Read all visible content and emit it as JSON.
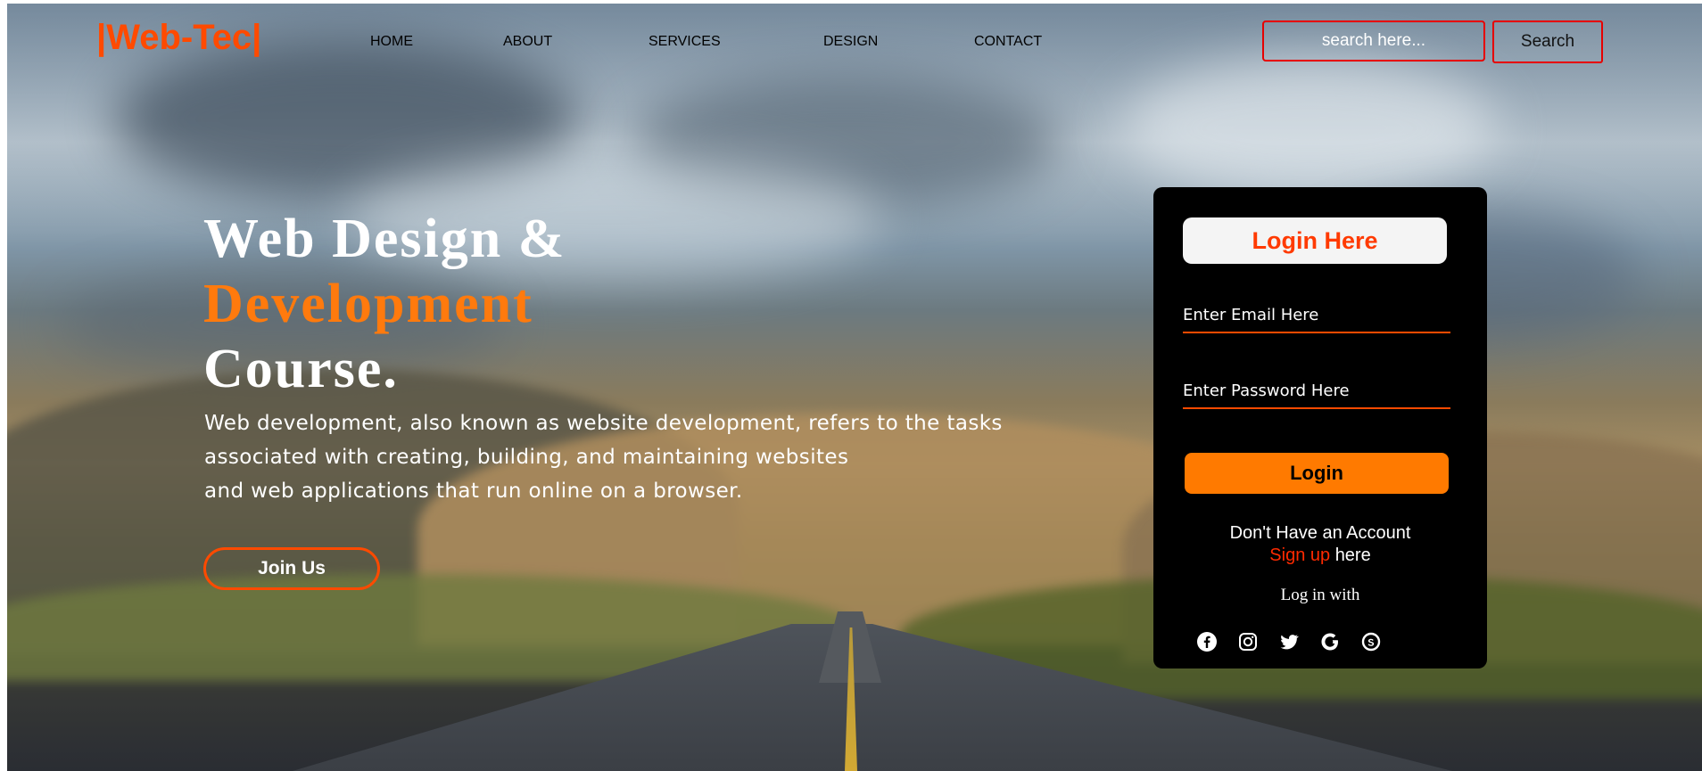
{
  "header": {
    "logo": "|Web-Tec|",
    "nav": [
      {
        "label": "HOME"
      },
      {
        "label": "ABOUT"
      },
      {
        "label": "SERVICES"
      },
      {
        "label": "DESIGN"
      },
      {
        "label": "CONTACT"
      }
    ],
    "search": {
      "placeholder": "search here...",
      "button_label": "Search"
    }
  },
  "hero": {
    "headline_line1": "Web Design &",
    "headline_line2": "Development",
    "headline_line3": "Course.",
    "description_line1": "Web development, also known as website development, refers to the tasks",
    "description_line2": "associated with creating, building, and maintaining websites",
    "description_line3": "and web applications that run online on a browser.",
    "join_label": "Join Us"
  },
  "login": {
    "title": "Login Here",
    "email_placeholder": "Enter Email Here",
    "password_placeholder": "Enter Password Here",
    "button_label": "Login",
    "no_account_text": "Don't Have an Account",
    "signup_link": "Sign up",
    "signup_suffix": "here",
    "login_with": "Log in with",
    "socials": [
      "facebook-icon",
      "instagram-icon",
      "twitter-icon",
      "google-icon",
      "skype-icon"
    ]
  },
  "colors": {
    "brand_orange": "#ff4a00",
    "accent_orange": "#ff7a0d",
    "search_border": "#e60000",
    "card_background": "#000000"
  }
}
